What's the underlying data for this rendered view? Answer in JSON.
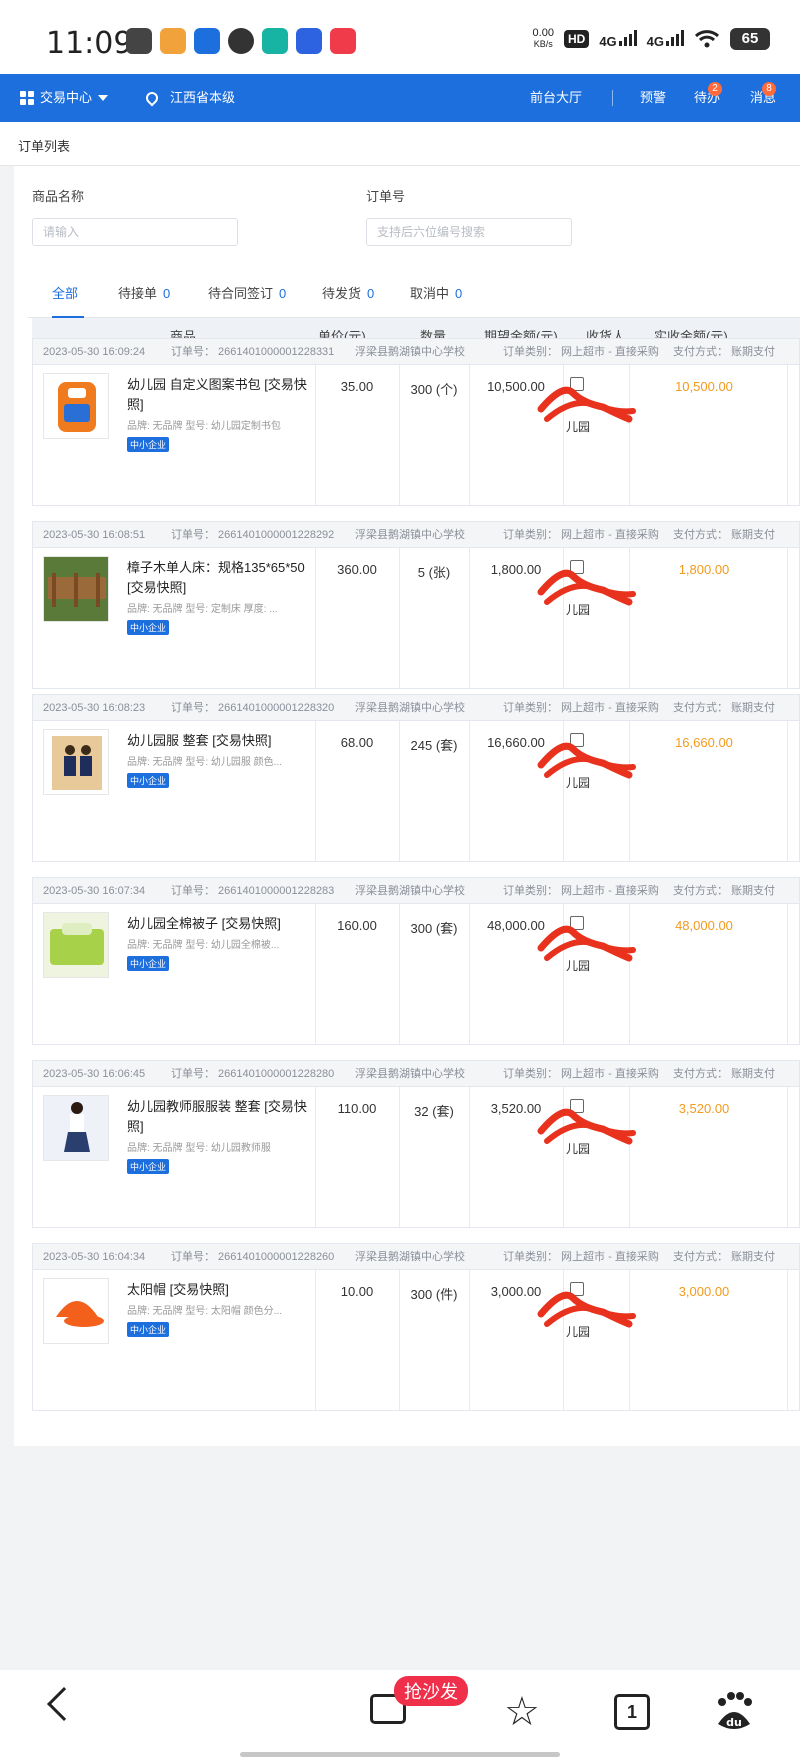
{
  "status_bar": {
    "time": "11:09",
    "net_speed": "0.00",
    "net_unit": "KB/s",
    "hd": "HD",
    "signal1": "4G",
    "signal2": "4G",
    "battery": "65"
  },
  "topnav": {
    "menu_label": "交易中心",
    "location": "江西省本级",
    "front_hall": "前台大厅",
    "warning": "预警",
    "todo": "待办",
    "todo_badge": "2",
    "messages": "消息",
    "messages_badge": "8"
  },
  "breadcrumb": "订单列表",
  "filters": {
    "product_label": "商品名称",
    "product_placeholder": "请输入",
    "order_label": "订单号",
    "order_placeholder": "支持后六位编号搜索"
  },
  "tabs": [
    {
      "label": "全部",
      "count": ""
    },
    {
      "label": "待接单",
      "count": "0"
    },
    {
      "label": "待合同签订",
      "count": "0"
    },
    {
      "label": "待发货",
      "count": "0"
    },
    {
      "label": "取消中",
      "count": "0"
    }
  ],
  "columns": [
    "商品",
    "单价(元)",
    "数量",
    "期望金额(元)",
    "收货人",
    "实收金额(元)"
  ],
  "orders": [
    {
      "time": "2023-05-30 16:09:24",
      "order_no": "订单号： 2661401000001228331",
      "school": "浮梁县鹅湖镇中心学校",
      "type": "订单类别： 网上超市 - 直接采购",
      "pay": "支付方式： 账期支付",
      "name": "幼儿园 自定义图案书包 [交易快照]",
      "meta": "品牌: 无品牌    型号: 幼儿园定制书包",
      "badge": "中小企业",
      "price": "35.00",
      "qty": "300 (个)",
      "expected": "10,500.00",
      "consignee": "儿园",
      "actual": "10,500.00",
      "thumb_color": "#f07a1e"
    },
    {
      "time": "2023-05-30 16:08:51",
      "order_no": "订单号： 2661401000001228292",
      "school": "浮梁县鹅湖镇中心学校",
      "type": "订单类别： 网上超市 - 直接采购",
      "pay": "支付方式： 账期支付",
      "name": "樟子木单人床：规格135*65*50 [交易快照]",
      "meta": "品牌: 无品牌    型号: 定制床    厚度: ...",
      "badge": "中小企业",
      "price": "360.00",
      "qty": "5 (张)",
      "expected": "1,800.00",
      "consignee": "儿园",
      "actual": "1,800.00",
      "thumb_color": "#9a6a3a"
    },
    {
      "time": "2023-05-30 16:08:23",
      "order_no": "订单号： 2661401000001228320",
      "school": "浮梁县鹅湖镇中心学校",
      "type": "订单类别： 网上超市 - 直接采购",
      "pay": "支付方式： 账期支付",
      "name": "幼儿园服 整套 [交易快照]",
      "meta": "品牌: 无品牌    型号: 幼儿园服    颜色...",
      "badge": "中小企业",
      "price": "68.00",
      "qty": "245 (套)",
      "expected": "16,660.00",
      "consignee": "儿园",
      "actual": "16,660.00",
      "thumb_color": "#e8c99a"
    },
    {
      "time": "2023-05-30 16:07:34",
      "order_no": "订单号： 2661401000001228283",
      "school": "浮梁县鹅湖镇中心学校",
      "type": "订单类别： 网上超市 - 直接采购",
      "pay": "支付方式： 账期支付",
      "name": "幼儿园全棉被子 [交易快照]",
      "meta": "品牌: 无品牌    型号: 幼儿园全棉被...",
      "badge": "中小企业",
      "price": "160.00",
      "qty": "300 (套)",
      "expected": "48,000.00",
      "consignee": "儿园",
      "actual": "48,000.00",
      "thumb_color": "#a8d14a"
    },
    {
      "time": "2023-05-30 16:06:45",
      "order_no": "订单号： 2661401000001228280",
      "school": "浮梁县鹅湖镇中心学校",
      "type": "订单类别： 网上超市 - 直接采购",
      "pay": "支付方式： 账期支付",
      "name": "幼儿园教师服服装 整套 [交易快照]",
      "meta": "品牌: 无品牌    型号: 幼儿园教师服",
      "badge": "中小企业",
      "price": "110.00",
      "qty": "32 (套)",
      "expected": "3,520.00",
      "consignee": "儿园",
      "actual": "3,520.00",
      "thumb_color": "#2a3f6e"
    },
    {
      "time": "2023-05-30 16:04:34",
      "order_no": "订单号： 2661401000001228260",
      "school": "浮梁县鹅湖镇中心学校",
      "type": "订单类别： 网上超市 - 直接采购",
      "pay": "支付方式： 账期支付",
      "name": "太阳帽 [交易快照]",
      "meta": "品牌: 无品牌    型号: 太阳帽    颜色分...",
      "badge": "中小企业",
      "price": "10.00",
      "qty": "300 (件)",
      "expected": "3,000.00",
      "consignee": "儿园",
      "actual": "3,000.00",
      "thumb_color": "#f2601c"
    }
  ],
  "bottom_bar": {
    "hot_label": "抢沙发",
    "tab_count": "1",
    "baidu_label": "du"
  },
  "colors": {
    "brand_blue": "#1e6fde",
    "amount_orange": "#f39a1c",
    "redaction_red": "#e8321e"
  }
}
